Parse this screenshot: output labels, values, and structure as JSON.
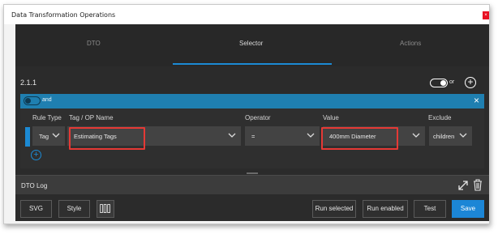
{
  "window": {
    "title": "Data Transformation Operations",
    "close_label": "×"
  },
  "tabs": [
    {
      "label": "DTO",
      "active": false
    },
    {
      "label": "Selector",
      "active": true
    },
    {
      "label": "Actions",
      "active": false
    }
  ],
  "section": {
    "number": "2.1.1",
    "or_label": "or",
    "add_label": "+"
  },
  "group": {
    "and_label": "and",
    "close_label": "×"
  },
  "rule": {
    "columns": [
      "Rule Type",
      "Tag / OP Name",
      "Operator",
      "Value",
      "Exclude"
    ],
    "rule_type": "Tag",
    "tag_name": "Estimating Tags",
    "operator": "=",
    "value": "400mm Diameter",
    "exclude": "children",
    "add_label": "+"
  },
  "log": {
    "title": "DTO Log"
  },
  "footer": {
    "svg": "SVG",
    "style": "Style",
    "run_selected": "Run selected",
    "run_enabled": "Run enabled",
    "test": "Test",
    "save": "Save"
  },
  "colors": {
    "accent": "#1c8ad4",
    "highlight": "#e53935",
    "panel": "#2b2b2b"
  },
  "icons": [
    "chevron-down-icon",
    "plus-circle-icon",
    "close-icon",
    "expand-icon",
    "trash-icon",
    "columns-icon"
  ]
}
